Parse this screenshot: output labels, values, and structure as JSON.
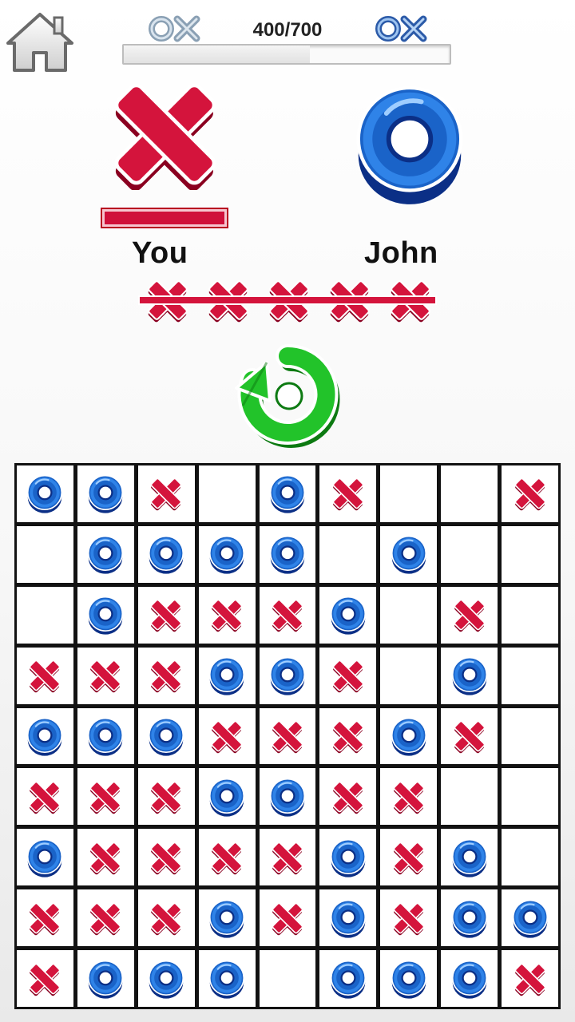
{
  "header": {
    "home_icon": "home-icon",
    "logo_left": "ox-logo",
    "logo_right": "ox-logo",
    "score_text": "400/700",
    "progress_fraction": 0.571
  },
  "players": {
    "you": {
      "name": "You",
      "symbol": "X",
      "color": "#d4143c",
      "active": true
    },
    "opponent": {
      "name": "John",
      "symbol": "O",
      "color": "#1a63c8"
    }
  },
  "win_streak": {
    "count": 5,
    "symbol": "X",
    "icon": "x-mark-icon"
  },
  "restart_icon": "restart-arrow-icon",
  "colors": {
    "x": "#d4143c",
    "o": "#1a63c8",
    "restart": "#22c32a"
  },
  "board": [
    [
      "O",
      "O",
      "X",
      "",
      "O",
      "X",
      "",
      "",
      "X"
    ],
    [
      "",
      "O",
      "O",
      "O",
      "O",
      "",
      "O",
      "",
      ""
    ],
    [
      "",
      "O",
      "X",
      "X",
      "X",
      "O",
      "",
      "X",
      ""
    ],
    [
      "X",
      "X",
      "X",
      "O",
      "O",
      "X",
      "",
      "O",
      ""
    ],
    [
      "O",
      "O",
      "O",
      "X",
      "X",
      "X",
      "O",
      "X",
      ""
    ],
    [
      "X",
      "X",
      "X",
      "O",
      "O",
      "X",
      "X",
      "",
      ""
    ],
    [
      "O",
      "X",
      "X",
      "X",
      "X",
      "O",
      "X",
      "O",
      ""
    ],
    [
      "X",
      "X",
      "X",
      "O",
      "X",
      "O",
      "X",
      "O",
      "O"
    ],
    [
      "X",
      "O",
      "O",
      "O",
      "",
      "O",
      "O",
      "O",
      "X"
    ]
  ]
}
